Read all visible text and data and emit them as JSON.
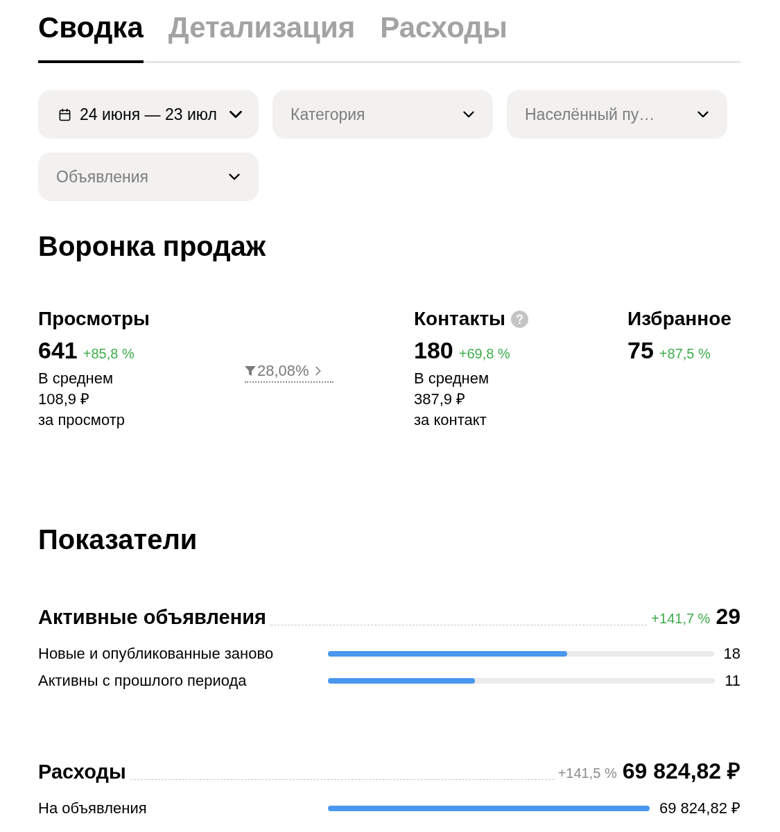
{
  "tabs": [
    {
      "label": "Сводка",
      "selected": true
    },
    {
      "label": "Детализация",
      "selected": false
    },
    {
      "label": "Расходы",
      "selected": false
    }
  ],
  "filters": [
    {
      "kind": "date",
      "value": "24 июня — 23 июл"
    },
    {
      "kind": "select",
      "placeholder": "Категория"
    },
    {
      "kind": "select",
      "placeholder": "Населённый пу…"
    },
    {
      "kind": "select",
      "placeholder": "Объявления"
    }
  ],
  "funnel": {
    "title": "Воронка продаж",
    "conversion": "28,08%",
    "stages": [
      {
        "title": "Просмотры",
        "help": false,
        "value": "641",
        "change": "+85,8 %",
        "note": [
          "В среднем",
          "108,9 ₽",
          "за просмотр"
        ]
      },
      {
        "title": "Контакты",
        "help": true,
        "value": "180",
        "change": "+69,8 %",
        "note": [
          "В среднем",
          "387,9 ₽",
          "за контакт"
        ]
      },
      {
        "title": "Избранное",
        "help": false,
        "value": "75",
        "change": "+87,5 %"
      }
    ]
  },
  "indicators": {
    "title": "Показатели",
    "sections": [
      {
        "title": "Активные объявления",
        "change": {
          "text": "+141,7 %",
          "color": "#3dad4b"
        },
        "total": "29",
        "rows": [
          {
            "label": "Новые и опубликованные заново",
            "level": 0.62,
            "value": "18"
          },
          {
            "label": "Активны с прошлого периода",
            "level": 0.38,
            "value": "11"
          }
        ]
      },
      {
        "title": "Расходы",
        "change": {
          "text": "+141,5 %",
          "color": "#8c8c8c"
        },
        "total": "69 824,82 ₽",
        "rows": [
          {
            "label": "На объявления",
            "level": 1,
            "value": "69 824,82 ₽"
          }
        ]
      }
    ]
  }
}
